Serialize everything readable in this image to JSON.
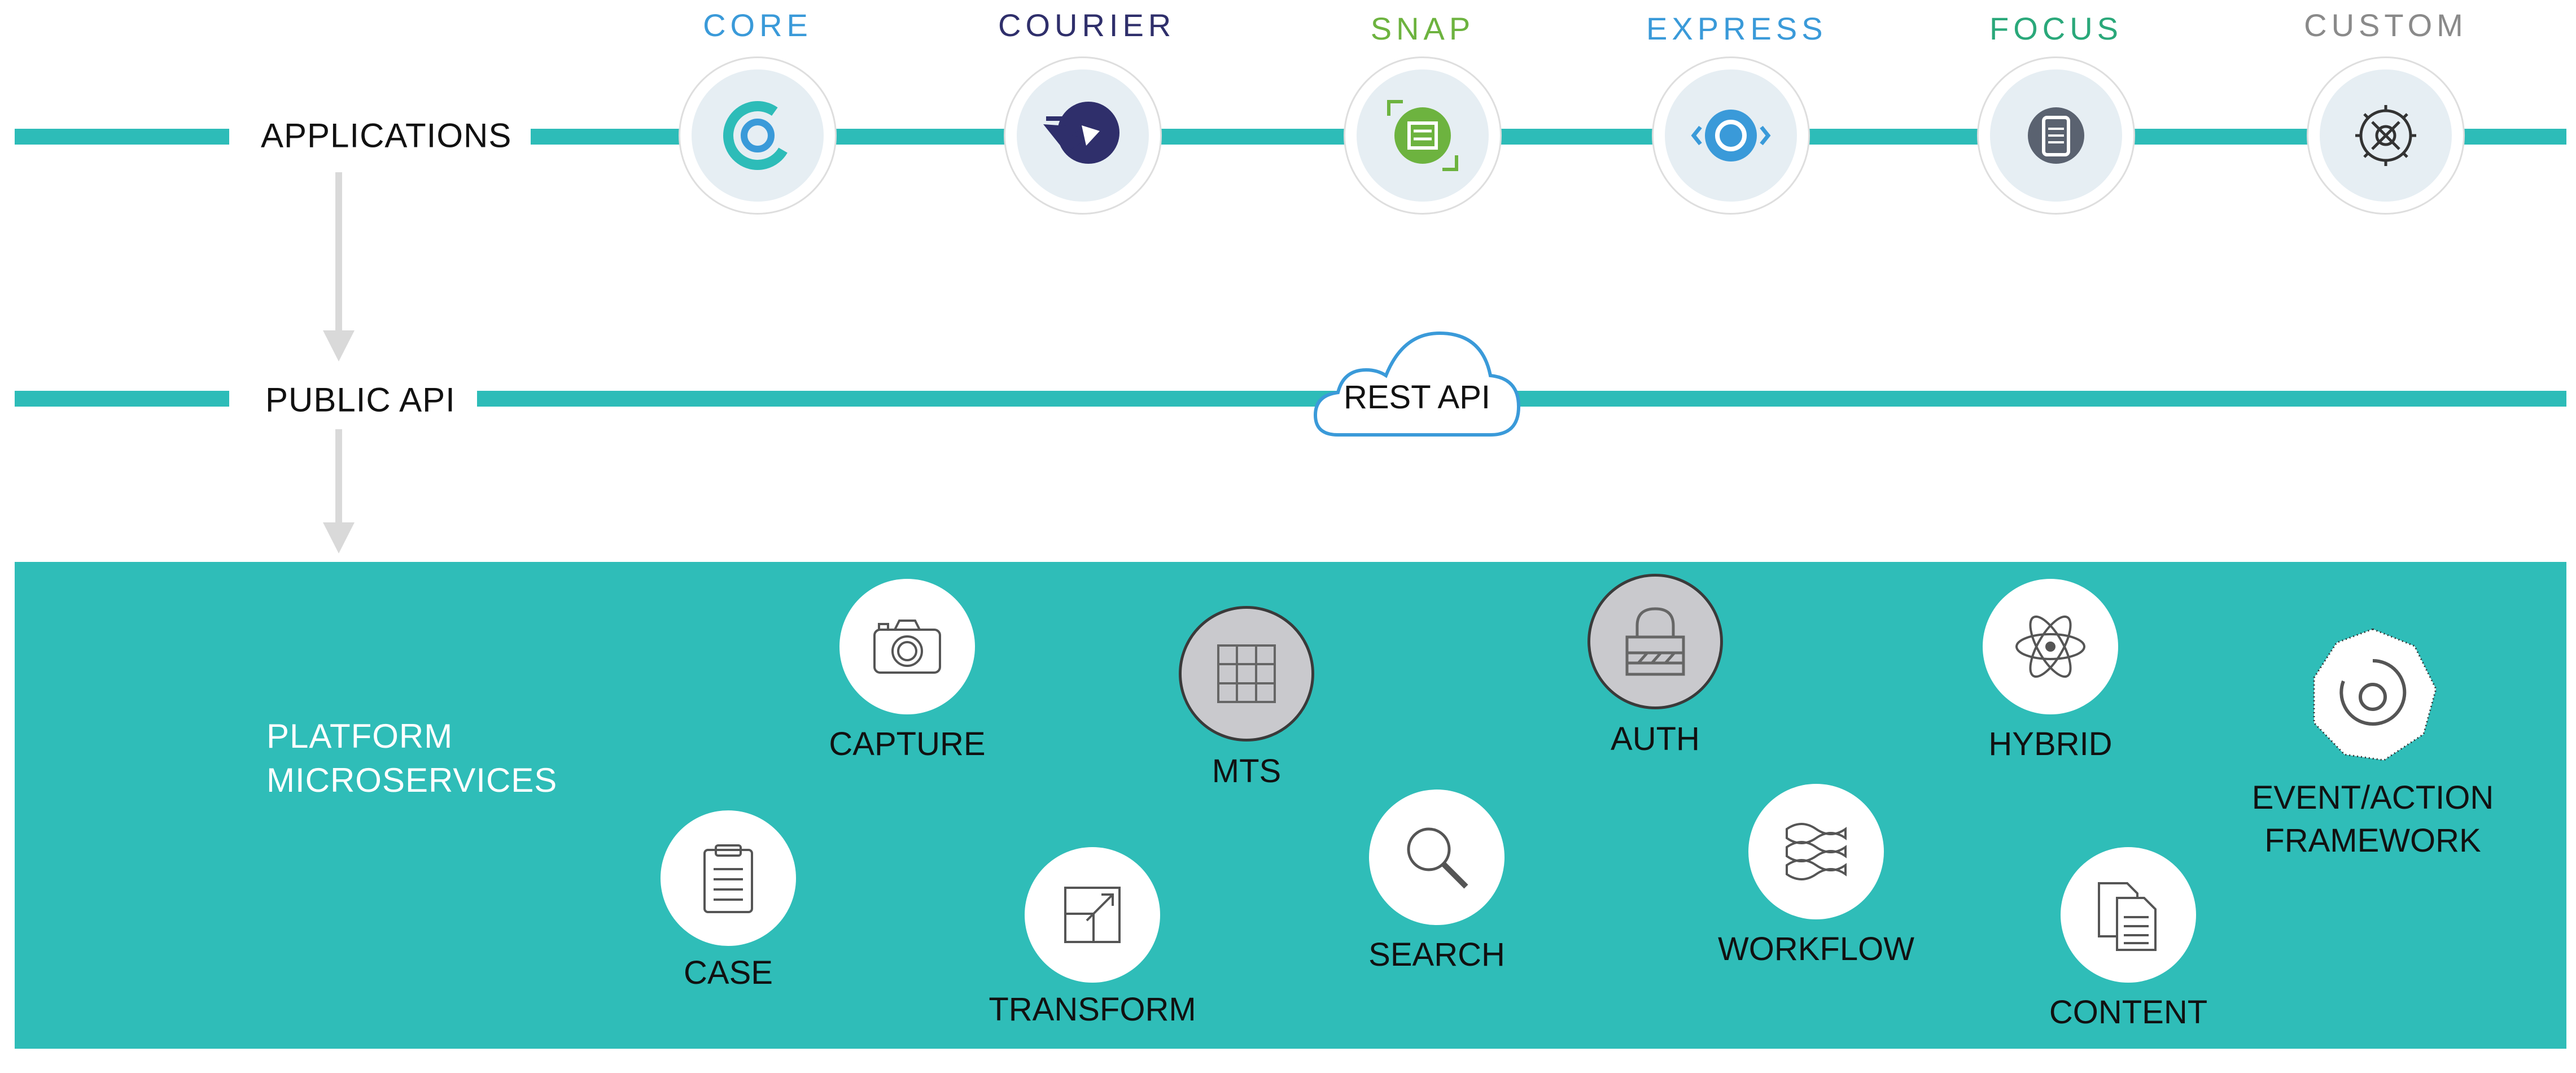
{
  "layers": {
    "applications": "APPLICATIONS",
    "public_api": "PUBLIC API",
    "platform": [
      "PLATFORM",
      "MICROSERVICES"
    ]
  },
  "applications": [
    {
      "name": "CORE",
      "color": "#3a9ad9",
      "icon": "core-logo-icon"
    },
    {
      "name": "COURIER",
      "color": "#2f2f6b",
      "icon": "courier-logo-icon"
    },
    {
      "name": "SNAP",
      "color": "#6db33f",
      "icon": "snap-logo-icon"
    },
    {
      "name": "EXPRESS",
      "color": "#3a9ad9",
      "icon": "express-logo-icon"
    },
    {
      "name": "FOCUS",
      "color": "#2aa87a",
      "icon": "focus-logo-icon"
    },
    {
      "name": "CUSTOM",
      "color": "#8a8a8a",
      "icon": "custom-gear-icon"
    }
  ],
  "api": {
    "label": "REST API",
    "icon": "cloud-icon"
  },
  "services": {
    "capture": "CAPTURE",
    "mts": "MTS",
    "auth": "AUTH",
    "hybrid": "HYBRID",
    "event_action": [
      "EVENT/ACTION",
      "FRAMEWORK"
    ],
    "case": "CASE",
    "transform": "TRANSFORM",
    "search": "SEARCH",
    "workflow": "WORKFLOW",
    "content": "CONTENT"
  },
  "colors": {
    "teal": "#2fbdb8",
    "arrow": "#d9d9d9"
  }
}
